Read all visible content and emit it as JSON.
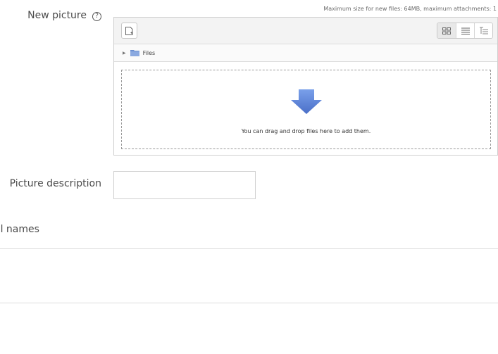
{
  "form": {
    "new_picture_label": "New picture",
    "help_glyph": "?",
    "max_size_note": "Maximum size for new files: 64MB, maximum attachments: 1",
    "picture_description_label": "Picture description",
    "picture_description_value": "",
    "section_heading": "al names"
  },
  "filemanager": {
    "path_root": "Files",
    "drop_text": "You can drag and drop files here to add them."
  },
  "icons": {
    "add_file": "add-file-icon",
    "view_icons": "grid-view-icon",
    "view_list": "list-view-icon",
    "view_tree": "tree-view-icon",
    "folder": "folder-icon",
    "drop_arrow": "arrow-down-icon"
  },
  "colors": {
    "arrow": "#5b7fd6",
    "folder": "#6b8fd0",
    "border": "#cfcfcf"
  }
}
